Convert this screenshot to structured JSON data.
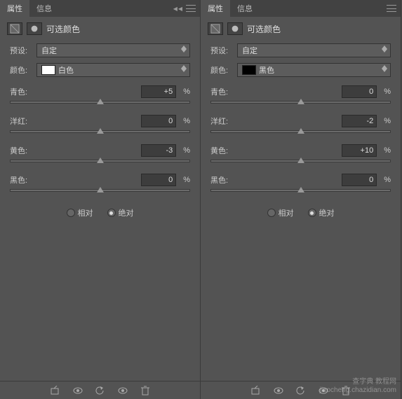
{
  "tab_properties": "属性",
  "tab_info": "信息",
  "panel_title": "可选颜色",
  "label_preset": "预设:",
  "label_color": "颜色:",
  "label_cyan": "青色:",
  "label_magenta": "洋红:",
  "label_yellow": "黄色:",
  "label_black": "黑色:",
  "percent": "%",
  "radio_relative": "相对",
  "radio_absolute": "绝对",
  "watermark_line1": "查字典 教程网",
  "watermark_line2": "jiaocheng.chazidian.com",
  "left": {
    "preset": "自定",
    "color": "白色",
    "swatch": "#ffffff",
    "cyan": "+5",
    "magenta": "0",
    "yellow": "-3",
    "black": "0",
    "selected": "absolute"
  },
  "right": {
    "preset": "自定",
    "color": "黑色",
    "swatch": "#000000",
    "cyan": "0",
    "magenta": "-2",
    "yellow": "+10",
    "black": "0",
    "selected": "absolute"
  }
}
